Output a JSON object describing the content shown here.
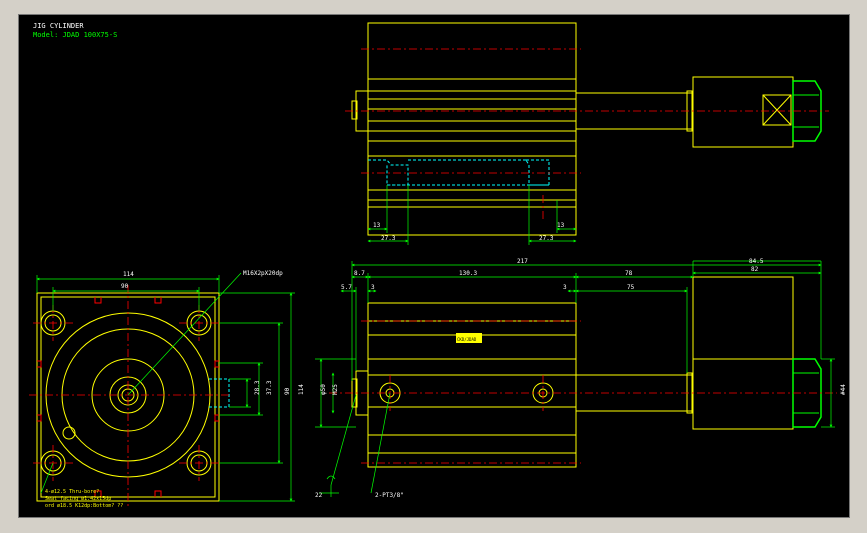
{
  "title_block": {
    "title": "JIG CYLINDER",
    "model": "Model: JDAD 100X75-S"
  },
  "colors": {
    "background": "#000000",
    "outline": "#ffff00",
    "dimension": "#00ff00",
    "centerline": "#ff0000",
    "hidden": "#00ffff",
    "text": "#ffffff"
  },
  "top_view": {
    "dims": {
      "left_13": "13",
      "left_27_3": "27.3",
      "right_27_3": "27.3",
      "right_13": "13"
    }
  },
  "front_view": {
    "dims": {
      "overall": "217",
      "rod_end": "84.5",
      "d8_7": "8.7",
      "d130_3": "130.3",
      "d78": "78",
      "d82": "82",
      "d5_7": "5.7",
      "d3_left": "3",
      "d3_right": "3",
      "d75": "75",
      "dia_rod": "φ50",
      "dia_inner": "M25",
      "hex": "#44",
      "d22": "22",
      "port": "2-PT3/8\""
    },
    "label": "CKD/JDAD"
  },
  "end_view": {
    "dims": {
      "width": "114",
      "pitch": "90",
      "h_pitch": "90",
      "h_overall": "114",
      "h_37_3": "37.3",
      "h_28_3": "28.3"
    },
    "callout_bolt": "M16X2pX20dp",
    "note_lines": [
      "4-ø12.5 Thru-bore?",
      "Seat facing  ø1.42x15dp",
      "ord ø18.5 K12dp:Bottom? ?? "
    ]
  }
}
